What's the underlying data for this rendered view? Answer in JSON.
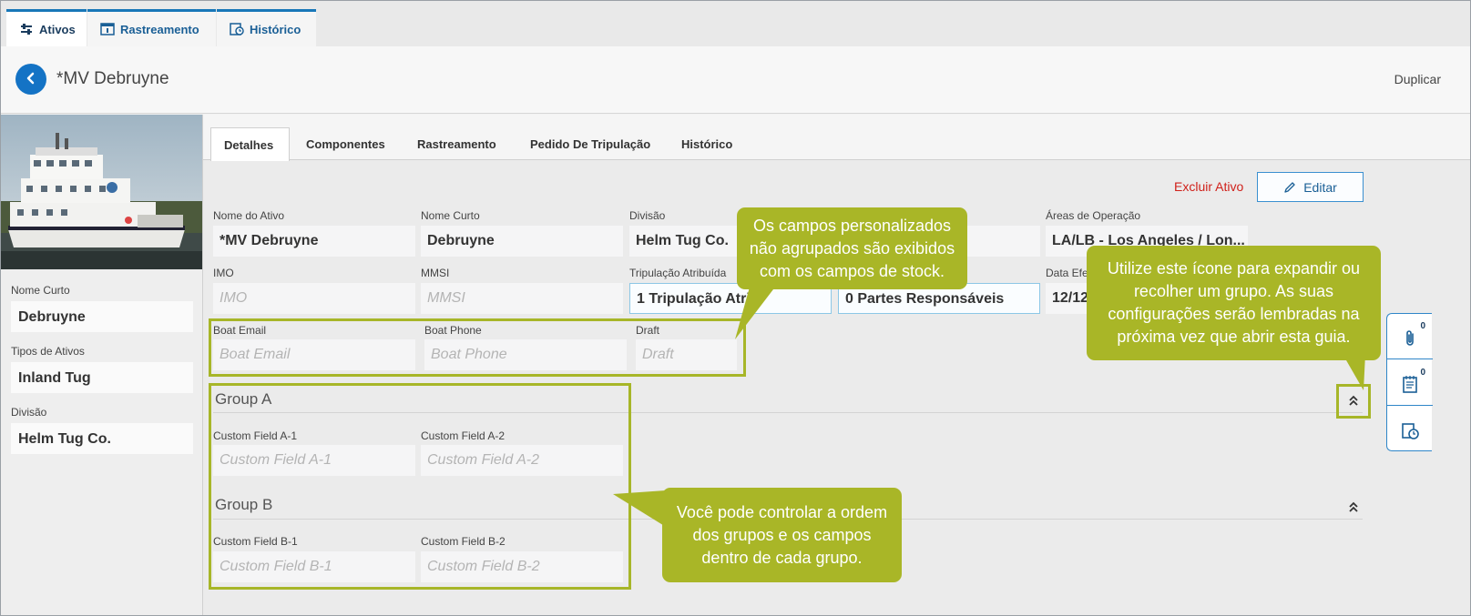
{
  "top_tabs": [
    {
      "label": "Ativos",
      "icon": "sliders-icon"
    },
    {
      "label": "Rastreamento",
      "icon": "tracking-icon"
    },
    {
      "label": "Histórico",
      "icon": "history-icon"
    }
  ],
  "header": {
    "title": "*MV Debruyne",
    "duplicate_label": "Duplicar"
  },
  "left_panel": {
    "fields": [
      {
        "label": "Nome Curto",
        "value": "Debruyne"
      },
      {
        "label": "Tipos de Ativos",
        "value": "Inland Tug"
      },
      {
        "label": "Divisão",
        "value": "Helm Tug Co."
      }
    ]
  },
  "sub_tabs": [
    "Detalhes",
    "Componentes",
    "Rastreamento",
    "Pedido De Tripulação",
    "Histórico"
  ],
  "actions": {
    "delete_label": "Excluir Ativo",
    "edit_label": "Editar"
  },
  "stock_fields": {
    "row1": [
      {
        "label": "Nome do Ativo",
        "value": "*MV Debruyne"
      },
      {
        "label": "Nome Curto",
        "value": "Debruyne"
      },
      {
        "label": "Divisão",
        "value": "Helm Tug Co."
      },
      {
        "label": "",
        "value": ""
      },
      {
        "label": "Áreas de Operação",
        "value": "LA/LB - Los Angeles / Lon..."
      }
    ],
    "row2": [
      {
        "label": "IMO",
        "placeholder": "IMO"
      },
      {
        "label": "MMSI",
        "placeholder": "MMSI"
      },
      {
        "label": "Tripulação Atribuída",
        "value": "1 Tripulação Atri"
      },
      {
        "label": "",
        "value": "0 Partes Responsáveis"
      },
      {
        "label": "Data Efe",
        "value": "12/12"
      }
    ]
  },
  "custom_ungrouped": [
    {
      "label": "Boat Email",
      "placeholder": "Boat Email"
    },
    {
      "label": "Boat Phone",
      "placeholder": "Boat Phone"
    },
    {
      "label": "Draft",
      "placeholder": "Draft"
    }
  ],
  "groups": [
    {
      "title": "Group A",
      "fields": [
        {
          "label": "Custom Field A-1",
          "placeholder": "Custom Field A-1"
        },
        {
          "label": "Custom Field A-2",
          "placeholder": "Custom Field A-2"
        }
      ]
    },
    {
      "title": "Group B",
      "fields": [
        {
          "label": "Custom Field B-1",
          "placeholder": "Custom Field B-1"
        },
        {
          "label": "Custom Field B-2",
          "placeholder": "Custom Field B-2"
        }
      ]
    }
  ],
  "right_rail": [
    {
      "icon": "paperclip-icon",
      "count": "0"
    },
    {
      "icon": "notes-icon",
      "count": "0"
    },
    {
      "icon": "history-icon",
      "count": ""
    }
  ],
  "callouts": {
    "stock": "Os campos personalizados não agrupados são exibidos com os campos de stock.",
    "expand": "Utilize este ícone para expandir ou recolher um grupo. As suas configurações serão lembradas na próxima vez que abrir esta guia.",
    "order": "Você pode controlar a ordem dos grupos e os campos dentro de cada grupo."
  },
  "colors": {
    "accent_blue": "#1473c5",
    "callout_green": "#a9b627",
    "delete_red": "#d0211b"
  }
}
